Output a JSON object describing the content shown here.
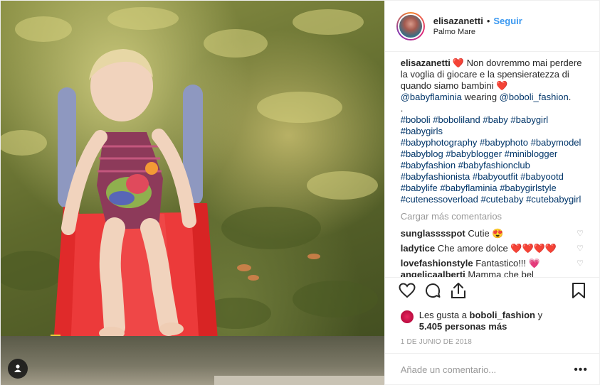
{
  "post": {
    "username": "elisazanetti",
    "follow_label": "Seguir",
    "separator": "•",
    "location": "Palmo Mare",
    "caption_text": " Non dovremmo mai perdere la voglia di giocare e la spensieratezza di quando siamo bambini ",
    "mention1": "@babyflaminia",
    "caption_mid": " wearing ",
    "mention2": "@boboli_fashion",
    "caption_end": ".",
    "dot_line": ".",
    "hashtags": [
      "#boboli #boboliland #baby #babygirl",
      "#babygirls",
      "#babyphotography #babyphoto #babymodel",
      "#babyblog #babyblogger #miniblogger",
      "#babyfashion #babyfashionclub",
      "#babyfashionista #babyoutfit #babyootd",
      "#babylife #babyflaminia #babygirlstyle",
      "#cutenessoverload #cutebaby #cutebabygirl"
    ],
    "load_more": "Cargar más comentarios",
    "comments": [
      {
        "user": "sunglasssspot",
        "text": "Cutie 😍"
      },
      {
        "user": "ladytice",
        "text": "Che amore dolce ❤️❤️❤️❤️"
      },
      {
        "user": "lovefashionstyle",
        "text": "Fantastico!!! 💗"
      },
      {
        "user": "angelicaalberti",
        "text": "Mamma che bel"
      }
    ],
    "likes_prefix": "Les gusta a ",
    "likes_user": "boboli_fashion",
    "likes_mid": " y",
    "likes_count": "5.405 personas más",
    "date": "1 DE JUNIO DE 2018",
    "add_comment_placeholder": "Añade un comentario...",
    "options_glyph": "•••"
  },
  "colors": {
    "link": "#3897f0",
    "accent_heart": "#ed1c24",
    "muted": "#999999"
  },
  "icons": [
    "heart-icon",
    "comment-icon",
    "share-icon",
    "bookmark-icon",
    "user-icon",
    "small-heart-icon"
  ]
}
